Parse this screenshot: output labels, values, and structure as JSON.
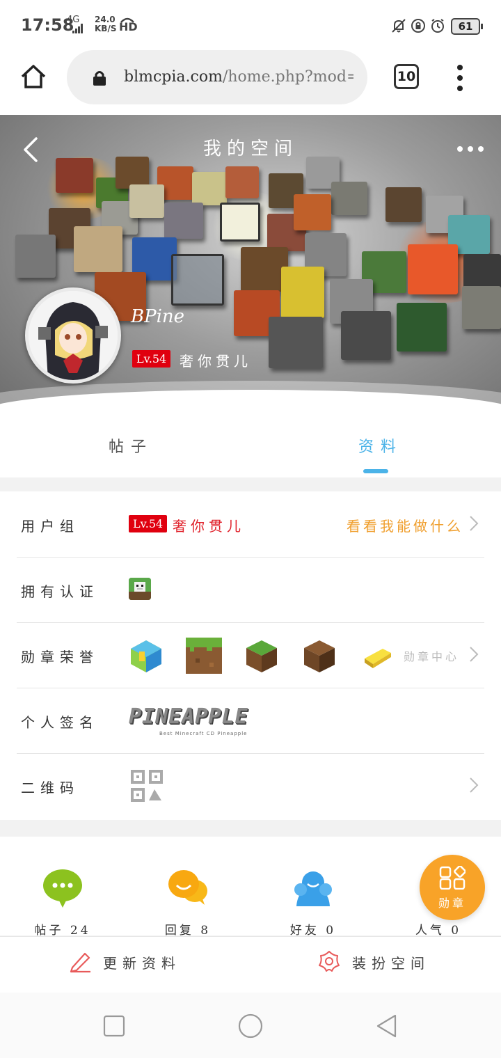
{
  "status_bar": {
    "time": "17:58",
    "network": "4G",
    "speed_value": "24.0",
    "speed_unit": "KB/S",
    "hd": "HD",
    "battery": "61"
  },
  "browser": {
    "url_host": "blmcpia.com",
    "url_path": "/home.php?mod=space&uid",
    "tab_count": "10"
  },
  "header": {
    "title": "我的空间",
    "username": "BPine",
    "level": "Lv.54",
    "rank": "奢你贯儿"
  },
  "tabs": [
    {
      "label": "帖子",
      "active": false
    },
    {
      "label": "资料",
      "active": true
    }
  ],
  "profile": {
    "user_group_label": "用户组",
    "user_group_level": "Lv.54",
    "user_group_rank": "奢你贯儿",
    "user_group_link": "看看我能做什么",
    "cert_label": "拥有认证",
    "medal_label": "勋章荣誉",
    "medal_center": "勋章中心",
    "signature_label": "个人签名",
    "signature_text": "PINEAPPLE",
    "signature_subtext": "Best Minecraft CD Pineapple",
    "qr_label": "二维码"
  },
  "stats": [
    {
      "label": "帖子",
      "value": "24"
    },
    {
      "label": "回复",
      "value": "8"
    },
    {
      "label": "好友",
      "value": "0"
    },
    {
      "label": "人气",
      "value": "0"
    }
  ],
  "fab": {
    "label": "勋章"
  },
  "actions": {
    "update_profile": "更新资料",
    "decorate_space": "装扮空间"
  },
  "colors": {
    "accent_blue": "#4bb3e8",
    "level_red": "#e0000f",
    "link_orange": "#f0a030",
    "fab_orange": "#f8a328",
    "posts_green": "#8cc21f",
    "replies_yellow": "#f8b818",
    "friends_blue": "#3aa0e8"
  }
}
